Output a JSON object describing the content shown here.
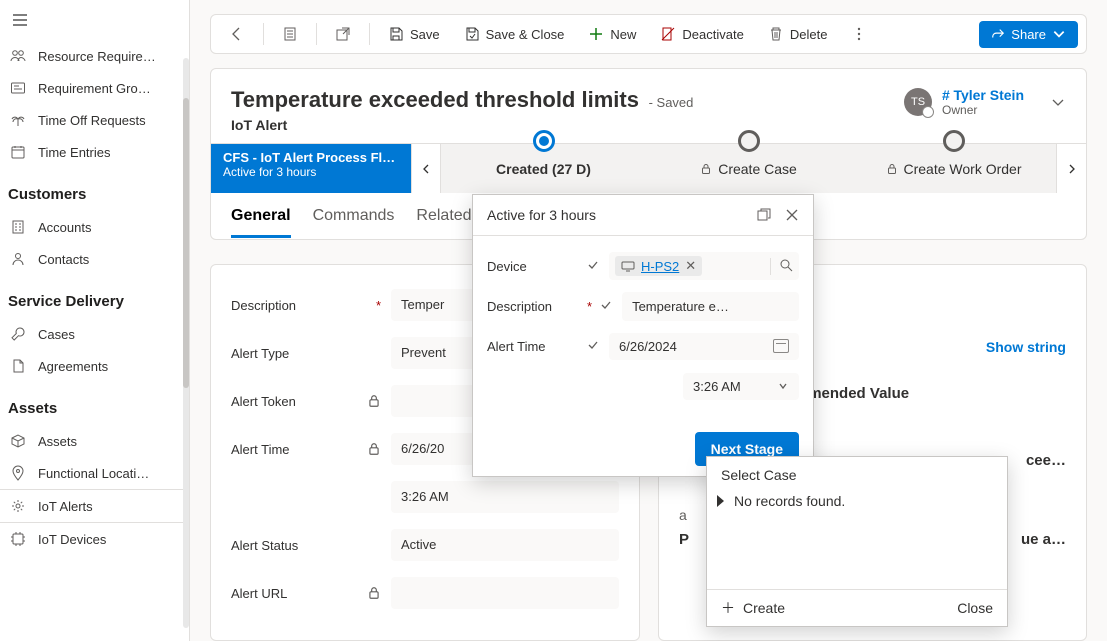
{
  "sidebar": {
    "groups": [
      {
        "items": [
          {
            "label": "Resource Require…"
          },
          {
            "label": "Requirement Gro…"
          },
          {
            "label": "Time Off Requests"
          },
          {
            "label": "Time Entries"
          }
        ]
      },
      {
        "title": "Customers",
        "items": [
          {
            "label": "Accounts"
          },
          {
            "label": "Contacts"
          }
        ]
      },
      {
        "title": "Service Delivery",
        "items": [
          {
            "label": "Cases"
          },
          {
            "label": "Agreements"
          }
        ]
      },
      {
        "title": "Assets",
        "items": [
          {
            "label": "Assets"
          },
          {
            "label": "Functional Locati…"
          },
          {
            "label": "IoT Alerts",
            "selected": true
          },
          {
            "label": "IoT Devices"
          }
        ]
      }
    ]
  },
  "commands": {
    "save": "Save",
    "save_close": "Save & Close",
    "new": "New",
    "deactivate": "Deactivate",
    "delete": "Delete",
    "share": "Share"
  },
  "record": {
    "title": "Temperature exceeded threshold limits",
    "status": "- Saved",
    "entity": "IoT Alert",
    "owner_initials": "TS",
    "owner_prefix": "#",
    "owner_name": "Tyler Stein",
    "owner_label": "Owner"
  },
  "bpf": {
    "flow_name": "CFS - IoT Alert Process Fl…",
    "flow_sub": "Active for 3 hours",
    "stages": {
      "created": "Created  (27 D)",
      "case": "Create Case",
      "wo": "Create Work Order"
    }
  },
  "tabs": {
    "general": "General",
    "commands": "Commands",
    "related": "Related"
  },
  "form": {
    "description_label": "Description",
    "description_value": "Temper",
    "alert_type_label": "Alert Type",
    "alert_type_value": "Prevent",
    "alert_token_label": "Alert Token",
    "alert_time_label": "Alert Time",
    "alert_time_date": "6/26/20",
    "alert_time_time": "3:26 AM",
    "alert_status_label": "Alert Status",
    "alert_status_value": "Active",
    "alert_url_label": "Alert URL"
  },
  "right": {
    "show_string": "Show string",
    "line1": "Exceeding Recommended Value",
    "line2": "cee…",
    "line3": "a",
    "line4_left": "P",
    "line4_right": "ue a…"
  },
  "flyout": {
    "header": "Active for 3 hours",
    "device_label": "Device",
    "device_value": "H-PS2",
    "description_label": "Description",
    "description_value": "Temperature e…",
    "alert_time_label": "Alert Time",
    "alert_time_date": "6/26/2024",
    "alert_time_time": "3:26 AM",
    "next_stage": "Next Stage"
  },
  "lookup_dd": {
    "title": "Select Case",
    "empty": "No records found.",
    "create": "Create",
    "close": "Close"
  }
}
